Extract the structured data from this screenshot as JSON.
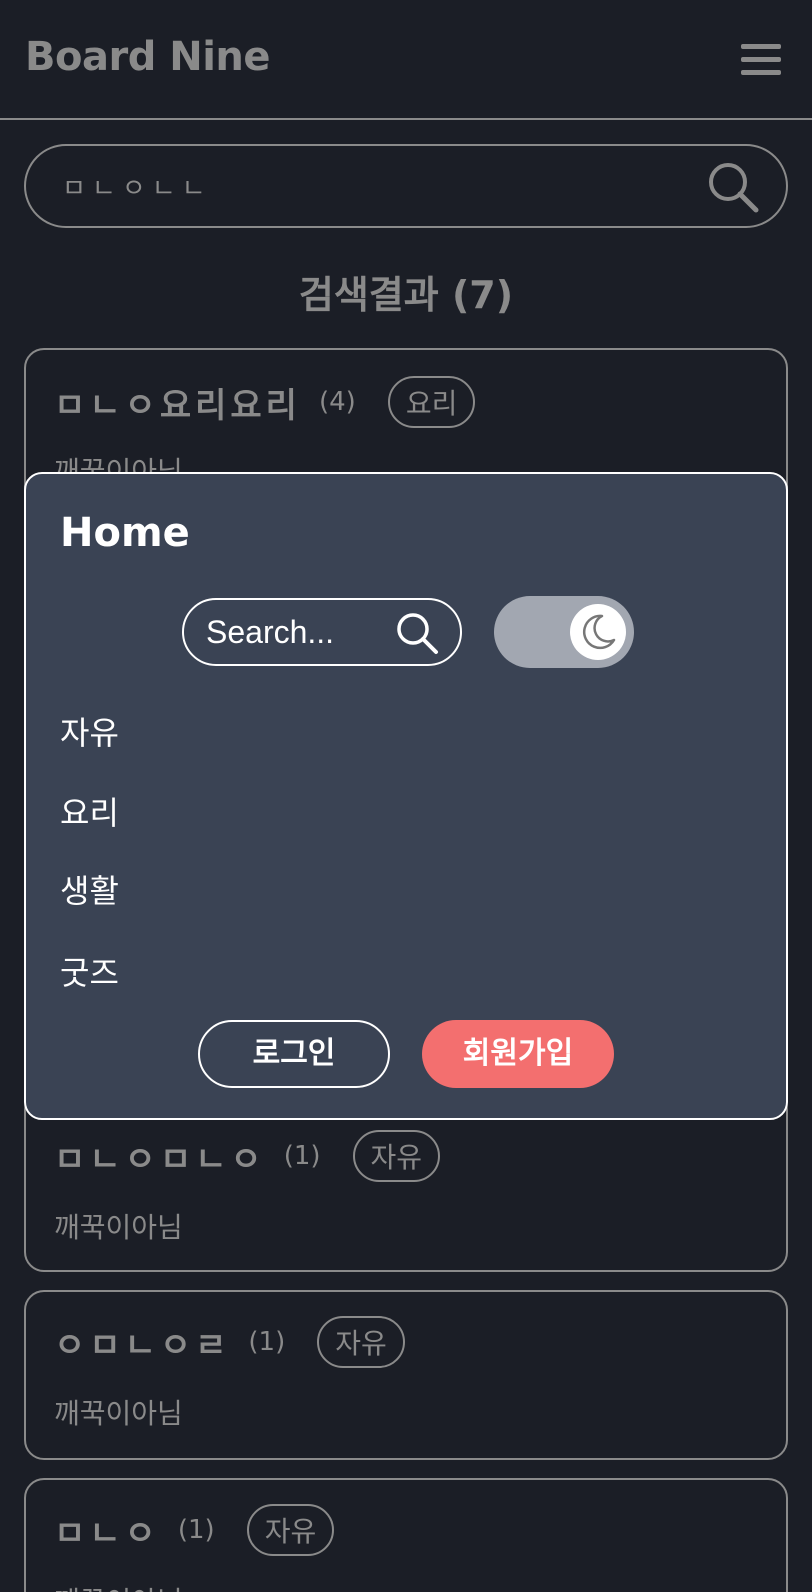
{
  "header": {
    "brand": "Board Nine"
  },
  "search": {
    "value": "ㅁㄴㅇㄴㄴ"
  },
  "results": {
    "title": "검색결과 (7)"
  },
  "cards": [
    {
      "title": "ㅁㄴㅇ요리요리",
      "count": "(4)",
      "tag": "요리",
      "author": "깨꾹이아님"
    },
    {
      "title": "ㅁㄴㅇㅁㄴㅇ",
      "count": "(1)",
      "tag": "자유",
      "author": "깨꾹이아님"
    },
    {
      "title": "ㅇㅁㄴㅇㄹ",
      "count": "(1)",
      "tag": "자유",
      "author": "깨꾹이아님"
    },
    {
      "title": "ㅁㄴㅇ",
      "count": "(1)",
      "tag": "자유",
      "author": "깨꾹이아님"
    }
  ],
  "menu": {
    "home": "Home",
    "search_placeholder": "Search...",
    "items": [
      "자유",
      "요리",
      "생활",
      "굿즈"
    ],
    "login_label": "로그인",
    "signup_label": "회원가입"
  },
  "colors": {
    "background": "#1b1e26",
    "panel": "#3a4354",
    "muted": "#8a8a8a",
    "toggle_track": "#a2a7b1",
    "signup": "#f36f6f"
  },
  "icons": {
    "menu": "hamburger-icon",
    "search": "search-icon",
    "theme": "moon-icon"
  }
}
